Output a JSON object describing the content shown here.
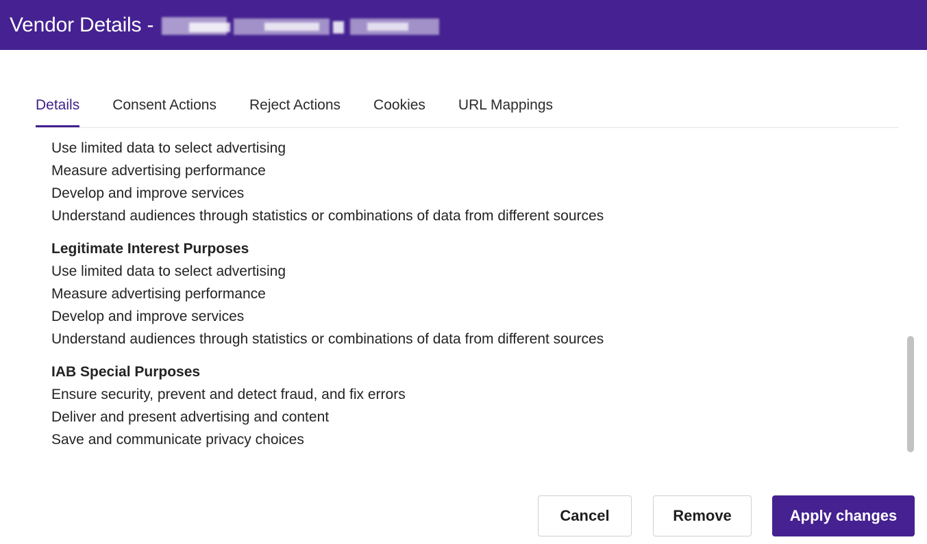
{
  "header": {
    "title": "Vendor Details -",
    "bg_color": "#452191"
  },
  "tabs": [
    {
      "label": "Details",
      "active": true
    },
    {
      "label": "Consent Actions",
      "active": false
    },
    {
      "label": "Reject Actions",
      "active": false
    },
    {
      "label": "Cookies",
      "active": false
    },
    {
      "label": "URL Mappings",
      "active": false
    }
  ],
  "details": {
    "purposes": [
      "Use limited data to select advertising",
      "Measure advertising performance",
      "Develop and improve services",
      "Understand audiences through statistics or combinations of data from different sources"
    ],
    "legitimate_interest": {
      "heading": "Legitimate Interest Purposes",
      "items": [
        "Use limited data to select advertising",
        "Measure advertising performance",
        "Develop and improve services",
        "Understand audiences through statistics or combinations of data from different sources"
      ]
    },
    "special_purposes": {
      "heading": "IAB Special Purposes",
      "items": [
        "Ensure security, prevent and detect fraud, and fix errors",
        "Deliver and present advertising and content",
        "Save and communicate privacy choices"
      ]
    }
  },
  "footer": {
    "cancel_label": "Cancel",
    "remove_label": "Remove",
    "apply_label": "Apply changes",
    "accent_color": "#452191"
  }
}
